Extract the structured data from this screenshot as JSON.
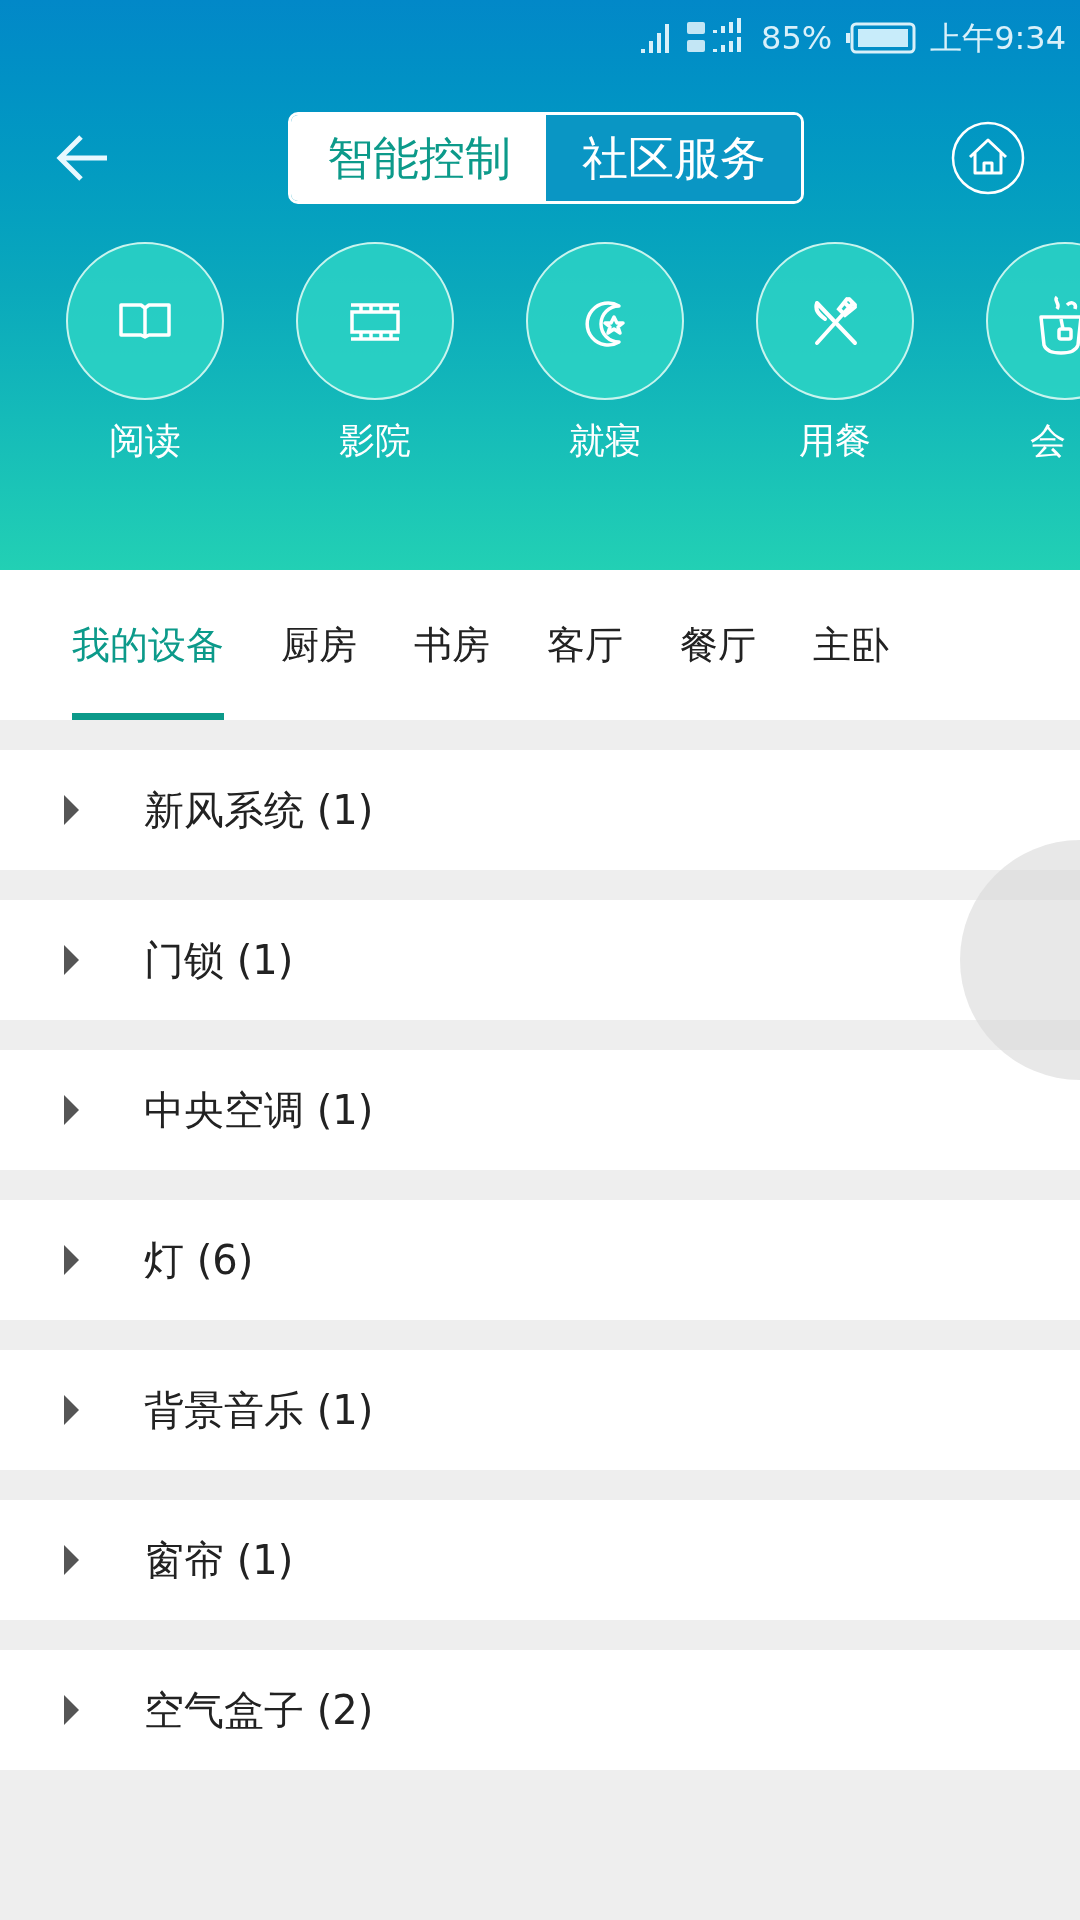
{
  "status_bar": {
    "battery_text": "85%",
    "time": "上午9:34"
  },
  "header": {
    "segments": [
      {
        "label": "智能控制",
        "selected": true
      },
      {
        "label": "社区服务",
        "selected": false
      }
    ]
  },
  "scenes": [
    {
      "label": "阅读",
      "kind": "book"
    },
    {
      "label": "影院",
      "kind": "film"
    },
    {
      "label": "就寝",
      "kind": "moon"
    },
    {
      "label": "用餐",
      "kind": "dining"
    },
    {
      "label": "会",
      "kind": "tea"
    }
  ],
  "room_tabs": [
    {
      "label": "我的设备",
      "selected": true
    },
    {
      "label": "厨房",
      "selected": false
    },
    {
      "label": "书房",
      "selected": false
    },
    {
      "label": "客厅",
      "selected": false
    },
    {
      "label": "餐厅",
      "selected": false
    },
    {
      "label": "主卧",
      "selected": false
    }
  ],
  "device_groups": [
    {
      "label": "新风系统 (1)",
      "expanded": false
    },
    {
      "label": "门锁 (1)",
      "expanded": false
    },
    {
      "label": "中央空调 (1)",
      "expanded": false
    },
    {
      "label": "灯 (6)",
      "expanded": false
    },
    {
      "label": "背景音乐 (1)",
      "expanded": false
    },
    {
      "label": "窗帘 (1)",
      "expanded": false
    },
    {
      "label": "空气盒子 (2)",
      "expanded": false
    }
  ]
}
